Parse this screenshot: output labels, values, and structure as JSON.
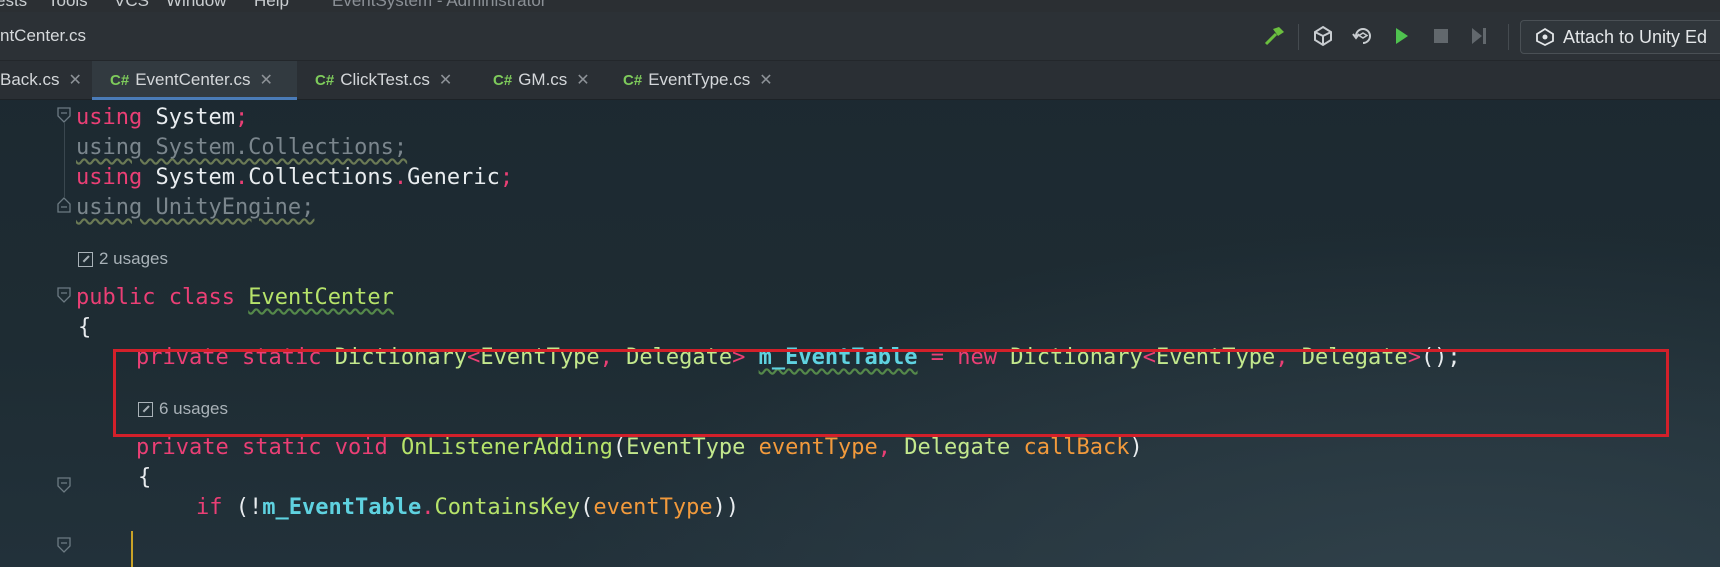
{
  "menubar": {
    "items": [
      "ests",
      "Tools",
      "VCS",
      "Window",
      "Help"
    ],
    "title": "EventSystem - Administrator"
  },
  "toolbar": {
    "breadcrumb": "ntCenter.cs",
    "icons": [
      "hammer-icon",
      "unity-icon",
      "refresh-unity-icon",
      "run-icon",
      "stop-icon",
      "step-icon"
    ],
    "attach_label": "Attach to Unity Ed"
  },
  "tabs": [
    {
      "badge": "",
      "label": "Back.cs",
      "active": false
    },
    {
      "badge": "C#",
      "label": "EventCenter.cs",
      "active": true
    },
    {
      "badge": "C#",
      "label": "ClickTest.cs",
      "active": false
    },
    {
      "badge": "C#",
      "label": "GM.cs",
      "active": false
    },
    {
      "badge": "C#",
      "label": "EventType.cs",
      "active": false
    }
  ],
  "code": {
    "l1": {
      "kw": "using",
      "ns": "System",
      "semi": ";"
    },
    "l2": "using System.Collections;",
    "l3": {
      "kw": "using",
      "ns1": "System",
      "dot1": ".",
      "ns2": "Collections",
      "dot2": ".",
      "ns3": "Generic",
      "semi": ";"
    },
    "l4": "using UnityEngine;",
    "usages_class": "2 usages",
    "class_kw1": "public",
    "class_kw2": "class",
    "class_name": "EventCenter",
    "brace_open": "{",
    "field": {
      "mod1": "private",
      "mod2": "static",
      "type": "Dictionary",
      "lt": "<",
      "t1": "EventType",
      "comma": ",",
      "t2": "Delegate",
      "gt": ">",
      "name": "m_EventTable",
      "eq": "=",
      "new": "new",
      "type2": "Dictionary",
      "lt2": "<",
      "t3": "EventType",
      "comma2": ",",
      "t4": "Delegate",
      "gt2": ">",
      "tail": "();"
    },
    "usages_method": "6 usages",
    "method": {
      "mod1": "private",
      "mod2": "static",
      "ret": "void",
      "name": "OnListenerAdding",
      "open": "(",
      "p1type": "EventType",
      "p1": "eventType",
      "comma": ",",
      "p2type": "Delegate",
      "p2": "callBack",
      "close": ")"
    },
    "method_brace": "{",
    "if_line": {
      "kw": "if",
      "open": "(!",
      "field": "m_EventTable",
      "dot": ".",
      "fn": "ContainsKey",
      "p": "(",
      "arg": "eventType",
      "close": "))"
    }
  },
  "colors": {
    "keyword": "#ea3f75",
    "type": "#c3e88d",
    "field": "#5fd2e0",
    "param": "#f29a3c",
    "highlight_box": "#d3202a",
    "tab_underline": "#4a7bb7"
  }
}
